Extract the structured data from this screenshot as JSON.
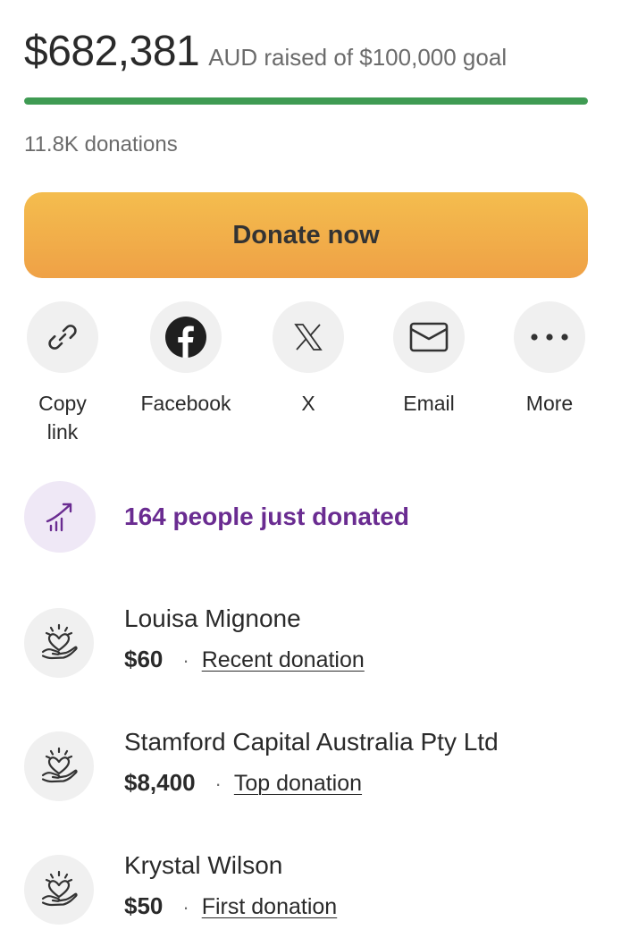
{
  "fundraiser": {
    "amount_raised": "$682,381",
    "raised_suffix": "AUD raised of $100,000 goal",
    "progress_fraction": 1.0,
    "donation_count": "11.8K donations",
    "progress_color": "#3f9b53"
  },
  "donate_button": {
    "label": "Donate now",
    "gradient_top": "#f4bd4e",
    "gradient_bottom": "#efa146"
  },
  "share": {
    "items": [
      {
        "label": "Copy\nlink",
        "icon": "link-icon"
      },
      {
        "label": "Facebook",
        "icon": "facebook-icon"
      },
      {
        "label": "X",
        "icon": "x-logo-icon"
      },
      {
        "label": "Email",
        "icon": "email-icon"
      },
      {
        "label": "More",
        "icon": "more-dots-icon"
      }
    ]
  },
  "trend": {
    "text": "164 people just donated",
    "icon": "trending-up-icon",
    "color": "#6a2c91"
  },
  "donors": [
    {
      "name": "Louisa Mignone",
      "amount": "$60",
      "tag": "Recent donation",
      "icon": "heart-hand-icon"
    },
    {
      "name": "Stamford Capital Australia Pty Ltd",
      "amount": "$8,400",
      "tag": "Top donation",
      "icon": "heart-hand-icon"
    },
    {
      "name": "Krystal Wilson",
      "amount": "$50",
      "tag": "First donation",
      "icon": "heart-hand-icon"
    }
  ],
  "separator": "·"
}
